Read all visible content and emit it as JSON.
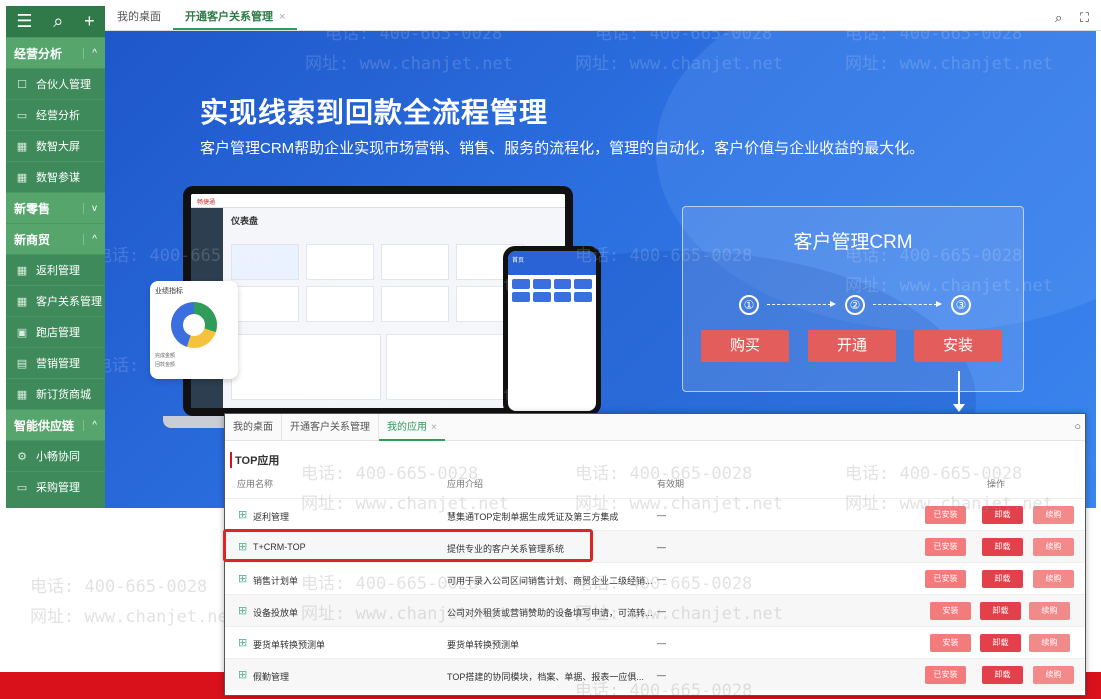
{
  "sidebar": {
    "top_icons": [
      "menu-icon",
      "search-icon",
      "plus-icon"
    ],
    "sections": [
      {
        "label": "经营分析",
        "chevron": "^",
        "items": [
          {
            "icon": "☐",
            "label": "合伙人管理"
          },
          {
            "icon": "▭",
            "label": "经营分析"
          },
          {
            "icon": "▦",
            "label": "数智大屏"
          },
          {
            "icon": "▦",
            "label": "数智参谋"
          }
        ]
      },
      {
        "label": "新零售",
        "chevron": "v",
        "items": []
      },
      {
        "label": "新商贸",
        "chevron": "^",
        "items": [
          {
            "icon": "▦",
            "label": "返利管理"
          },
          {
            "icon": "▦",
            "label": "客户关系管理"
          },
          {
            "icon": "▣",
            "label": "跑店管理"
          },
          {
            "icon": "▤",
            "label": "营销管理"
          },
          {
            "icon": "▦",
            "label": "新订货商城"
          }
        ]
      },
      {
        "label": "智能供应链",
        "chevron": "^",
        "items": [
          {
            "icon": "⚙",
            "label": "小畅协同"
          },
          {
            "icon": "▭",
            "label": "采购管理"
          }
        ]
      }
    ]
  },
  "tabbar": {
    "tabs": [
      {
        "label": "我的桌面",
        "active": false
      },
      {
        "label": "开通客户关系管理",
        "active": true,
        "close": "×"
      }
    ],
    "icons": [
      "search-icon",
      "fullscreen-icon"
    ]
  },
  "banner": {
    "headline": "实现线索到回款全流程管理",
    "subline": "客户管理CRM帮助企业实现市场营销、销售、服务的流程化，管理的自动化，客户价值与企业收益的最大化。",
    "laptop_brand": "畅捷通",
    "laptop_title": "仪表盘",
    "perf_title": "业绩指标",
    "perf_legend": [
      "完成金额",
      "回款金额"
    ],
    "phone_title": "首页",
    "crm_panel": {
      "title": "客户管理CRM",
      "steps": [
        "①",
        "②",
        "③"
      ],
      "buttons": [
        "购买",
        "开通",
        "安装"
      ]
    }
  },
  "popup": {
    "tabs": [
      {
        "label": "我的桌面",
        "active": false
      },
      {
        "label": "开通客户关系管理",
        "active": false
      },
      {
        "label": "我的应用",
        "active": true,
        "close": "×"
      }
    ],
    "section_title": "TOP应用",
    "columns": [
      "应用名称",
      "应用介绍",
      "有效期",
      "操作"
    ],
    "rows": [
      {
        "name": "返利管理",
        "desc": "慧集通TOP定制单据生成凭证及第三方集成",
        "validity": "—",
        "actions": [
          "已安装",
          "卸载",
          "续购"
        ]
      },
      {
        "name": "T+CRM-TOP",
        "desc": "提供专业的客户关系管理系统",
        "validity": "—",
        "actions": [
          "已安装",
          "卸载",
          "续购"
        ]
      },
      {
        "name": "销售计划单",
        "desc": "可用于录入公司区间销售计划、商贸企业二级经销...",
        "validity": "—",
        "actions": [
          "已安装",
          "卸载",
          "续购"
        ]
      },
      {
        "name": "设备投放单",
        "desc": "公司对外租赁或营销赞助的设备填写申请，可流转...",
        "validity": "—",
        "actions": [
          "安装",
          "卸载",
          "续购"
        ]
      },
      {
        "name": "要货单转换预测单",
        "desc": "要货单转换预测单",
        "validity": "—",
        "actions": [
          "安装",
          "卸载",
          "续购"
        ]
      },
      {
        "name": "假勤管理",
        "desc": "TOP搭建的协同模块，档案、单据、报表一应俱...",
        "validity": "—",
        "actions": [
          "已安装",
          "卸载",
          "续购"
        ]
      }
    ]
  },
  "watermark": {
    "phone": "电话: 400-665-0028",
    "site": "网址: www.chanjet.net"
  },
  "colors": {
    "sidebar": "#3f8a5a",
    "accent": "#2f9c5a",
    "banner": "#2c6fe0",
    "danger": "#e2404b",
    "brand_red": "#d9111b"
  }
}
